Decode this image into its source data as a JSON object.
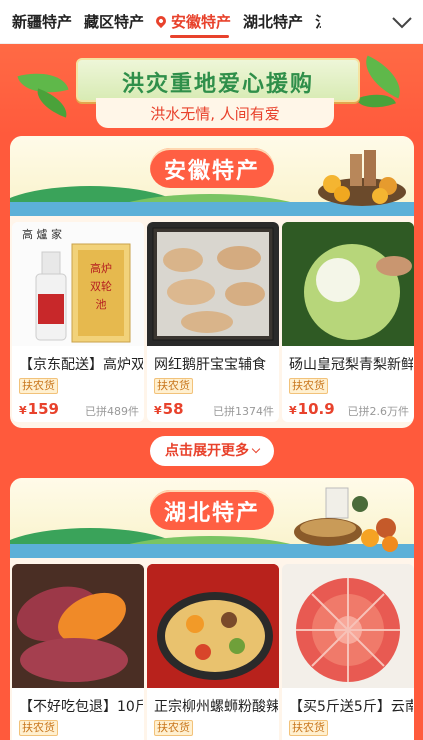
{
  "tabs": [
    {
      "label": "新疆特产",
      "active": false
    },
    {
      "label": "藏区特产",
      "active": false
    },
    {
      "label": "安徽特产",
      "active": true
    },
    {
      "label": "湖北特产",
      "active": false
    },
    {
      "label": "江",
      "active": false
    }
  ],
  "hero": {
    "title": "洪灾重地爱心援购",
    "subtitle": "洪水无情, 人间有爱"
  },
  "sections": [
    {
      "title": "安徽特产",
      "products": [
        {
          "name": "【京东配送】高炉双轮池",
          "badge": "扶农货",
          "currency": "¥",
          "price": "159",
          "sold": "已拼489件",
          "image": "baijiu-bottle"
        },
        {
          "name": "网红鹅肝宝宝辅食",
          "badge": "扶农货",
          "currency": "¥",
          "price": "58",
          "sold": "已拼1374件",
          "image": "goose-liver"
        },
        {
          "name": "砀山皇冠梨青梨新鲜",
          "badge": "扶农货",
          "currency": "¥",
          "price": "10.9",
          "sold": "已拼2.6万件",
          "image": "green-pear"
        }
      ],
      "expand_label": "点击展开更多"
    },
    {
      "title": "湖北特产",
      "products": [
        {
          "name": "【不好吃包退】10斤",
          "badge": "扶农货",
          "image": "sweet-potato"
        },
        {
          "name": "正宗柳州螺蛳粉酸辣",
          "badge": "扶农货",
          "image": "river-snail-noodles"
        },
        {
          "name": "【买5斤送5斤】云南",
          "badge": "扶农货",
          "image": "red-grapefruit"
        }
      ]
    }
  ],
  "colors": {
    "accent": "#e8422c",
    "page_bg": "#ff5a3c",
    "hero_green": "#2f8f4a",
    "badge": "#c9781f"
  }
}
